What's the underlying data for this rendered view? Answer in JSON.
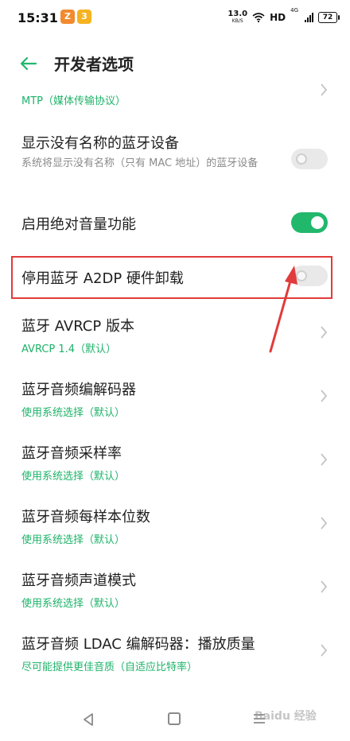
{
  "status_bar": {
    "time": "15:31",
    "notif_a": "Z",
    "notif_b": "3",
    "net_speed_value": "13.0",
    "net_speed_unit": "KB/S",
    "hd": "HD",
    "signal_label": "4G",
    "battery": "72"
  },
  "header": {
    "title": "开发者选项"
  },
  "items": [
    {
      "subtitle": "MTP（媒体传输协议）"
    },
    {
      "title": "显示没有名称的蓝牙设备",
      "subtitle": "系统将显示没有名称（只有 MAC 地址）的蓝牙设备",
      "toggle": false
    },
    {
      "title": "启用绝对音量功能",
      "toggle": true
    },
    {
      "title": "停用蓝牙 A2DP 硬件卸载",
      "toggle": false
    },
    {
      "title": "蓝牙 AVRCP 版本",
      "subtitle": "AVRCP 1.4（默认）"
    },
    {
      "title": "蓝牙音频编解码器",
      "subtitle": "使用系统选择（默认）"
    },
    {
      "title": "蓝牙音频采样率",
      "subtitle": "使用系统选择（默认）"
    },
    {
      "title": "蓝牙音频每样本位数",
      "subtitle": "使用系统选择（默认）"
    },
    {
      "title": "蓝牙音频声道模式",
      "subtitle": "使用系统选择（默认）"
    },
    {
      "title": "蓝牙音频 LDAC 编解码器：播放质量",
      "subtitle": "尽可能提供更佳音质（自适应比特率）"
    }
  ],
  "watermark": "Baidu 经验",
  "colors": {
    "accent": "#22b86c",
    "highlight": "#e13b3b"
  }
}
